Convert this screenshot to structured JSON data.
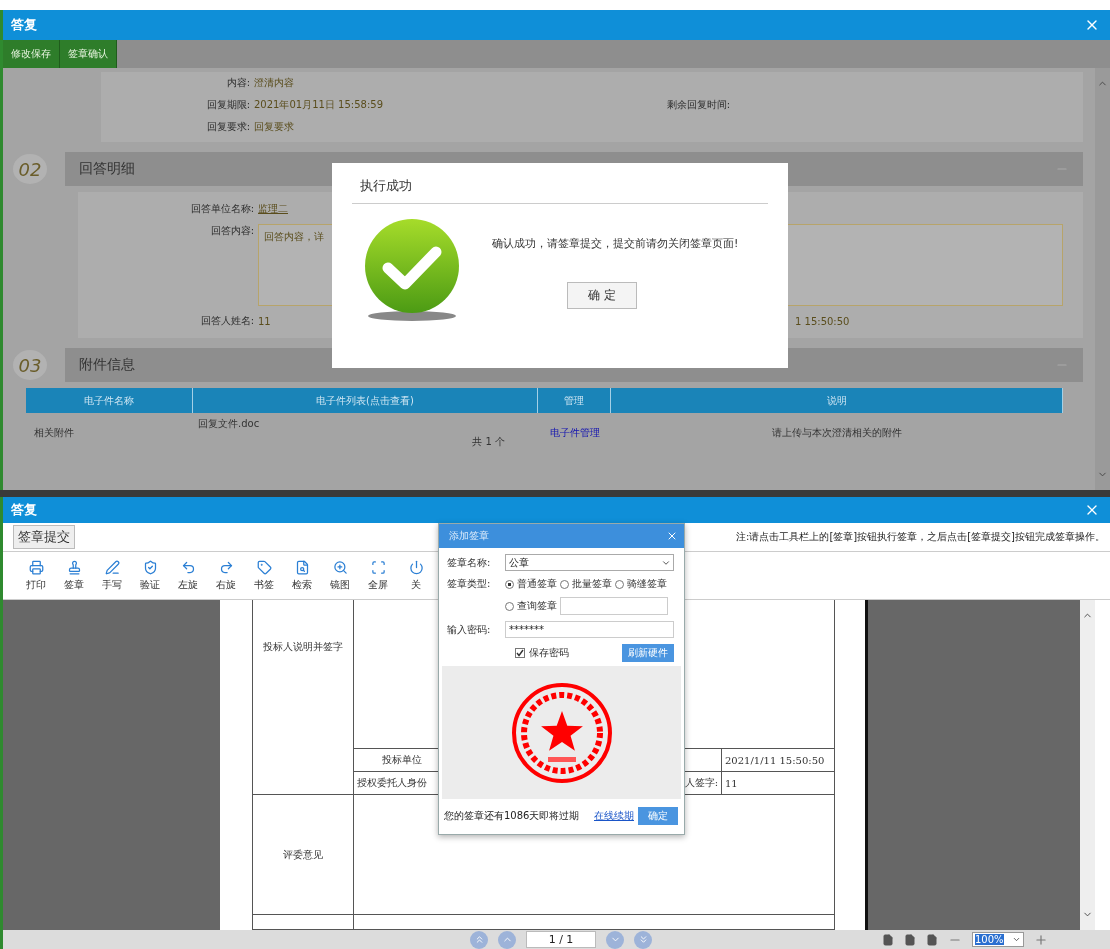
{
  "top_window": {
    "title": "答复",
    "toolbar": [
      "修改保存",
      "签章确认"
    ],
    "summary_rows": [
      {
        "fields": [
          {
            "label": "内容:",
            "value": "澄清内容"
          }
        ]
      },
      {
        "fields": [
          {
            "label": "回复期限:",
            "value": "2021年01月11日 15:58:59"
          },
          {
            "label": "剩余回复时间:"
          }
        ]
      },
      {
        "fields": [
          {
            "label": "回复要求:",
            "value": "回复要求"
          }
        ]
      }
    ],
    "answer_section": {
      "number": "02",
      "title": "回答明细",
      "unit": {
        "label": "回答单位名称:",
        "value": "监理二"
      },
      "content": {
        "label": "回答内容:",
        "value": "回答内容，详"
      },
      "person": {
        "label": "回答人姓名:",
        "value": "11"
      },
      "time_fragment": "1 15:50:50"
    },
    "attachment_section": {
      "number": "03",
      "title": "附件信息",
      "columns": [
        "电子件名称",
        "电子件列表(点击查看)",
        "管理",
        "说明"
      ],
      "rows": [
        {
          "name": "相关附件",
          "file": "回复文件.doc",
          "count": "共 1 个",
          "manage": "电子件管理",
          "note": "请上传与本次澄清相关的附件"
        }
      ]
    }
  },
  "success_dialog": {
    "title": "执行成功",
    "message": "确认成功，请签章提交，提交前请勿关闭签章页面!",
    "button": "确 定"
  },
  "bottom_window": {
    "title": "答复",
    "submit_button": "签章提交",
    "note": "注:请点击工具栏上的[签章]按钮执行签章，之后点击[签章提交]按钮完成签章操作。",
    "tools": [
      {
        "label": "打印"
      },
      {
        "label": "签章"
      },
      {
        "label": "手写"
      },
      {
        "label": "验证"
      },
      {
        "label": "左旋"
      },
      {
        "label": "右旋"
      },
      {
        "label": "书签"
      },
      {
        "label": "检索"
      },
      {
        "label": "镜图"
      },
      {
        "label": "全屏"
      },
      {
        "label": "关"
      }
    ],
    "document": {
      "sign_label": "投标人说明并签字",
      "unit_label": "投标单位",
      "time": "2021/1/11 15:50:50",
      "agent_label": "授权委托人身份",
      "signer_label": "人签字:",
      "signer_value": "11",
      "review_label": "评委意见"
    },
    "pager": {
      "page": "1 / 1",
      "zoom": "100%"
    }
  },
  "stamp_dialog": {
    "title": "添加签章",
    "name_label": "签章名称:",
    "name_value": "公章",
    "type_label": "签章类型:",
    "types": [
      {
        "label": "普通签章",
        "selected": true
      },
      {
        "label": "批量签章",
        "selected": false
      },
      {
        "label": "骑缝签章",
        "selected": false
      },
      {
        "label": "查询签章",
        "selected": false
      }
    ],
    "password_label": "输入密码:",
    "password": "*******",
    "save_password": {
      "label": "保存密码",
      "checked": true
    },
    "refresh_button": "刷新硬件",
    "expiry": "您的签章还有1086天即将过期",
    "renew_link": "在线续期",
    "ok_button": "确定"
  }
}
